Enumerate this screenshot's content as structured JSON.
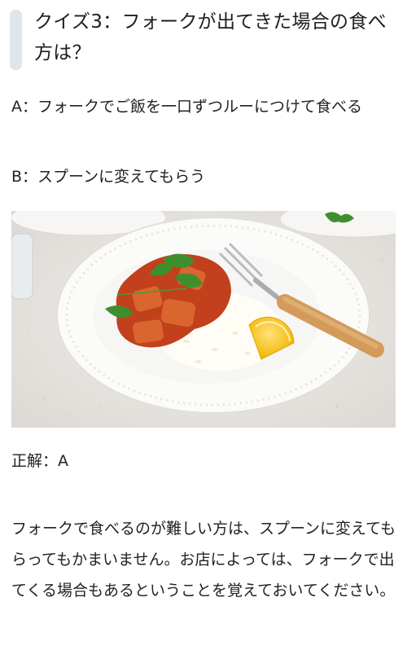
{
  "quiz": {
    "title": "クイズ3：フォークが出てきた場合の食べ方は？",
    "choice_a": "A：フォークでご飯を一口ずつルーにつけて食べる",
    "choice_b": "B：スプーンに変えてもらう",
    "image_alt": "curry-rice-plate-with-fork",
    "answer": "正解：A",
    "explanation": "フォークで食べるのが難しい方は、スプーンに変えてもらってもかまいません。お店によっては、フォークで出てくる場合もあるということを覚えておいてください。"
  },
  "colors": {
    "heading_bar": "#dbe7ec",
    "text": "#222222",
    "background": "#ffffff"
  }
}
